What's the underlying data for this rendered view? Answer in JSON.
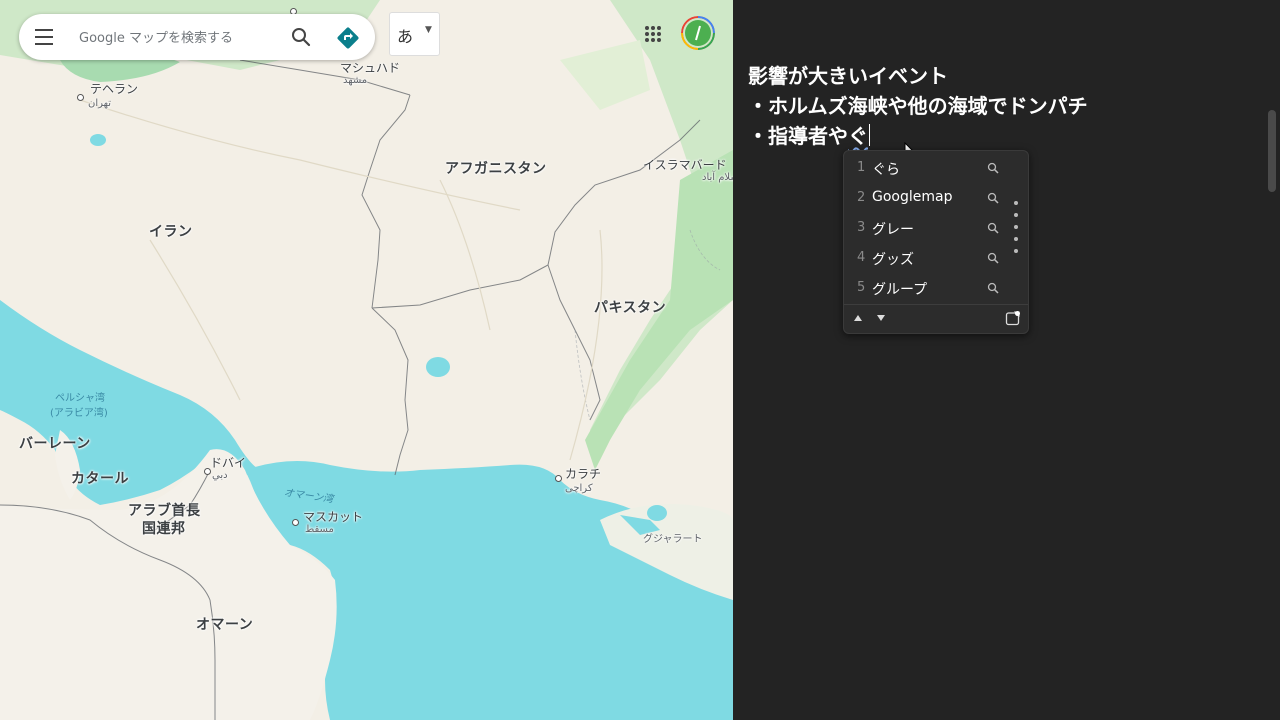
{
  "map": {
    "search_placeholder": "Google マップを検索する",
    "ime_mode": "あ",
    "labels": {
      "tehran": "テヘラン",
      "tehran_local": "تهران",
      "mashhad": "マシュハド",
      "mashhad_local": "مشهد",
      "afghanistan": "アフガニスタン",
      "islamabad": "イスラマバード",
      "islamabad_local": "اسلام آباد",
      "iran": "イラン",
      "pakistan": "パキスタン",
      "persian_gulf": "ペルシャ湾",
      "persian_gulf_alt": "(アラビア湾)",
      "bahrain": "バーレーン",
      "qatar": "カタール",
      "dubai": "ドバイ",
      "dubai_local": "دبي",
      "gulf_of_oman": "オマーン湾",
      "uae_line1": "アラブ首長",
      "uae_line2": "国連邦",
      "muscat": "マスカット",
      "muscat_local": "مسقط",
      "karachi": "カラチ",
      "karachi_local": "کراچی",
      "gujarat": "グジャラート",
      "oman": "オマーン"
    },
    "colors": {
      "land": "#f4f1ea",
      "water": "#7fdae3",
      "green": "#b7e0b3"
    }
  },
  "document": {
    "line1": "影響が大きいイベント",
    "line2": "・ホルムズ海峡や他の海域でドンパチ",
    "line3_committed": "・指導者や",
    "line3_composing": "ぐ"
  },
  "ime_candidates": [
    {
      "num": "1",
      "text": "ぐら"
    },
    {
      "num": "2",
      "text": "Googlemap"
    },
    {
      "num": "3",
      "text": "グレー"
    },
    {
      "num": "4",
      "text": "グッズ"
    },
    {
      "num": "5",
      "text": "グループ"
    }
  ],
  "icons": {
    "menu": "menu-icon",
    "search": "search-icon",
    "directions": "directions-icon",
    "apps": "apps-grid-icon",
    "avatar": "account-avatar",
    "candidate_search": "search-icon",
    "page_up": "triangle-up-icon",
    "page_down": "triangle-down-icon",
    "settings": "ime-settings-icon"
  }
}
